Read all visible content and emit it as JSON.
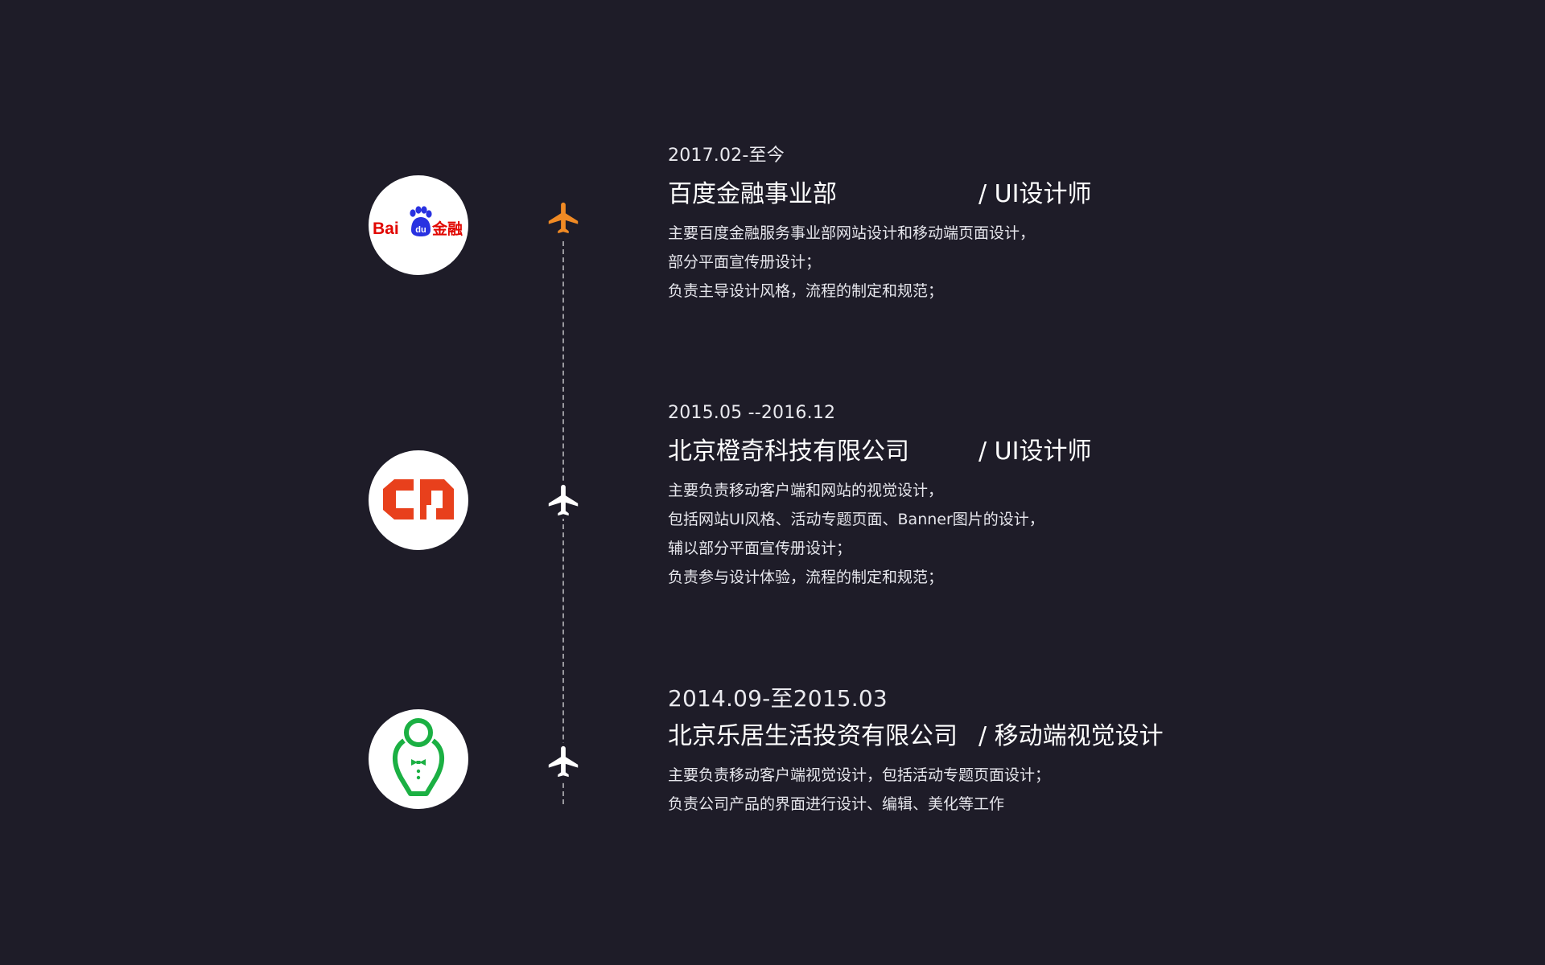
{
  "colors": {
    "background": "#1e1c28",
    "accent_orange": "#f08a24",
    "text": "#ffffff"
  },
  "entries": [
    {
      "date": "2017.02-至今",
      "company": "百度金融事业部",
      "role": "/ UI设计师",
      "desc": [
        "主要百度金融服务事业部网站设计和移动端页面设计，",
        "部分平面宣传册设计；",
        "负责主导设计风格，流程的制定和规范；"
      ],
      "logo": {
        "icon": "baidu-finance-logo",
        "text_bai": "Bai",
        "text_du": "du",
        "text_jinrong": "金融"
      },
      "plane": {
        "icon": "airplane-icon",
        "color": "#f08a24"
      }
    },
    {
      "date": "2015.05 --2016.12",
      "company": "北京橙奇科技有限公司",
      "role": "/ UI设计师",
      "desc": [
        "主要负责移动客户端和网站的视觉设计，",
        "包括网站UI风格、活动专题页面、Banner图片的设计，",
        "辅以部分平面宣传册设计；",
        "负责参与设计体验，流程的制定和规范；"
      ],
      "logo": {
        "icon": "cq-logo"
      },
      "plane": {
        "icon": "airplane-icon",
        "color": "#ffffff"
      }
    },
    {
      "date": "2014.09-至2015.03",
      "company": "北京乐居生活投资有限公司",
      "role": "/ 移动端视觉设计",
      "desc": [
        "主要负责移动客户端视觉设计，包括活动专题页面设计；",
        "负责公司产品的界面进行设计、编辑、美化等工作"
      ],
      "logo": {
        "icon": "butler-logo"
      },
      "plane": {
        "icon": "airplane-icon",
        "color": "#ffffff"
      }
    }
  ]
}
